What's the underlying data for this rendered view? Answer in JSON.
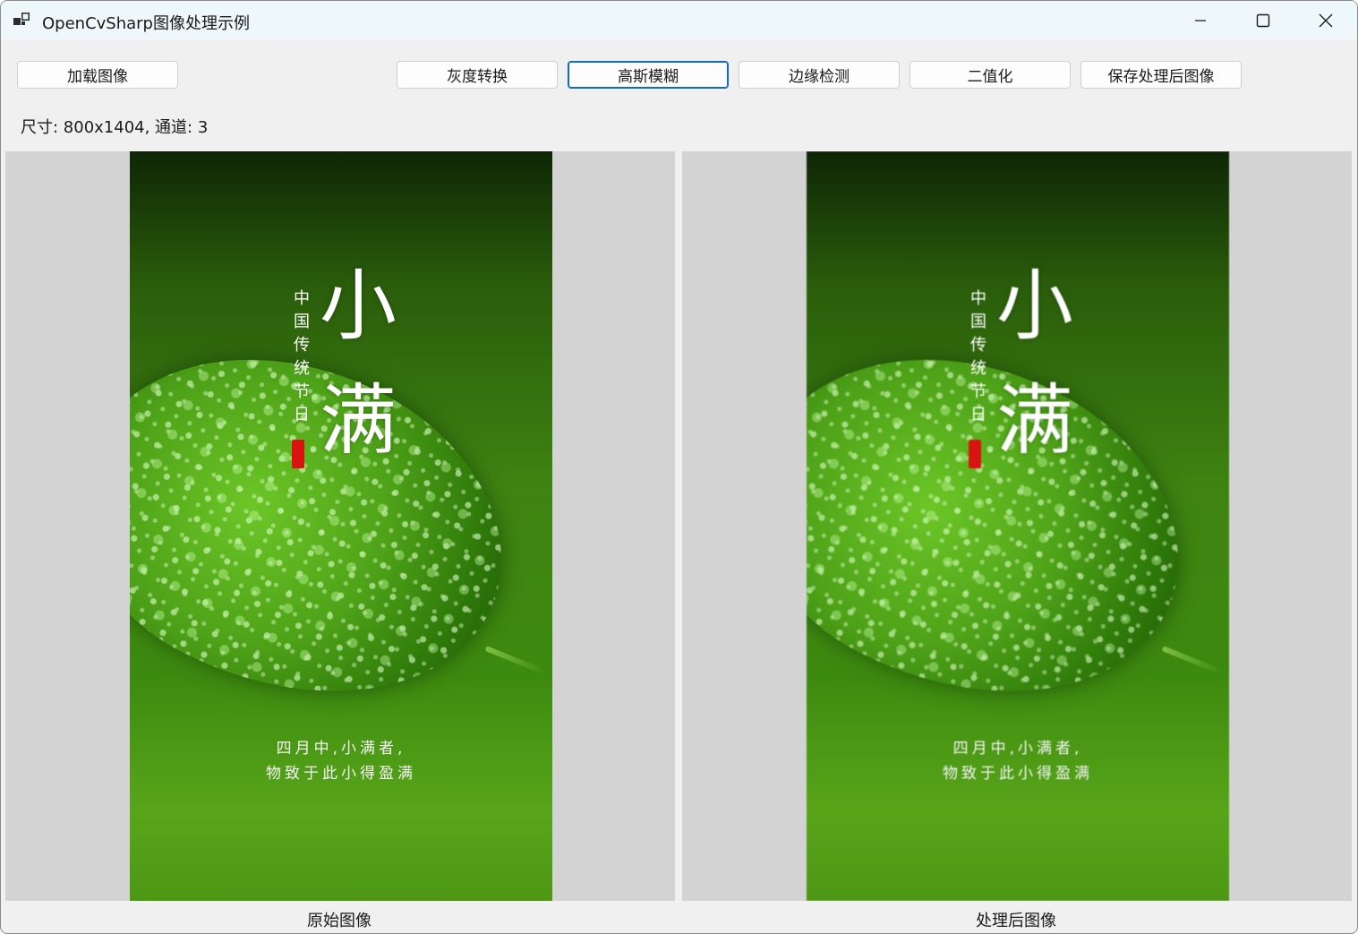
{
  "window": {
    "title": "OpenCvSharp图像处理示例"
  },
  "toolbar": {
    "load": "加载图像",
    "grayscale": "灰度转换",
    "gaussian_blur": "高斯模糊",
    "edge_detect": "边缘检测",
    "binarize": "二值化",
    "save": "保存处理后图像"
  },
  "info": {
    "text": "尺寸: 800x1404, 通道: 3"
  },
  "panels": [
    {
      "caption": "原始图像",
      "poster": {
        "char1": "小",
        "char2": "满",
        "vertical": "中国传统节日",
        "line1": "四月中,小满者,",
        "line2": "物致于此小得盈满"
      }
    },
    {
      "caption": "处理后图像",
      "poster": {
        "char1": "小",
        "char2": "满",
        "vertical": "中国传统节日",
        "line1": "四月中,小满者,",
        "line2": "物致于此小得盈满"
      }
    }
  ],
  "colors": {
    "title_bar": "#eef7fa",
    "client_bg": "#f0f0f0",
    "picture_box_bg": "#d3d3d3",
    "focus_accent": "#0f6cbd",
    "seal_red": "#d9130f"
  }
}
